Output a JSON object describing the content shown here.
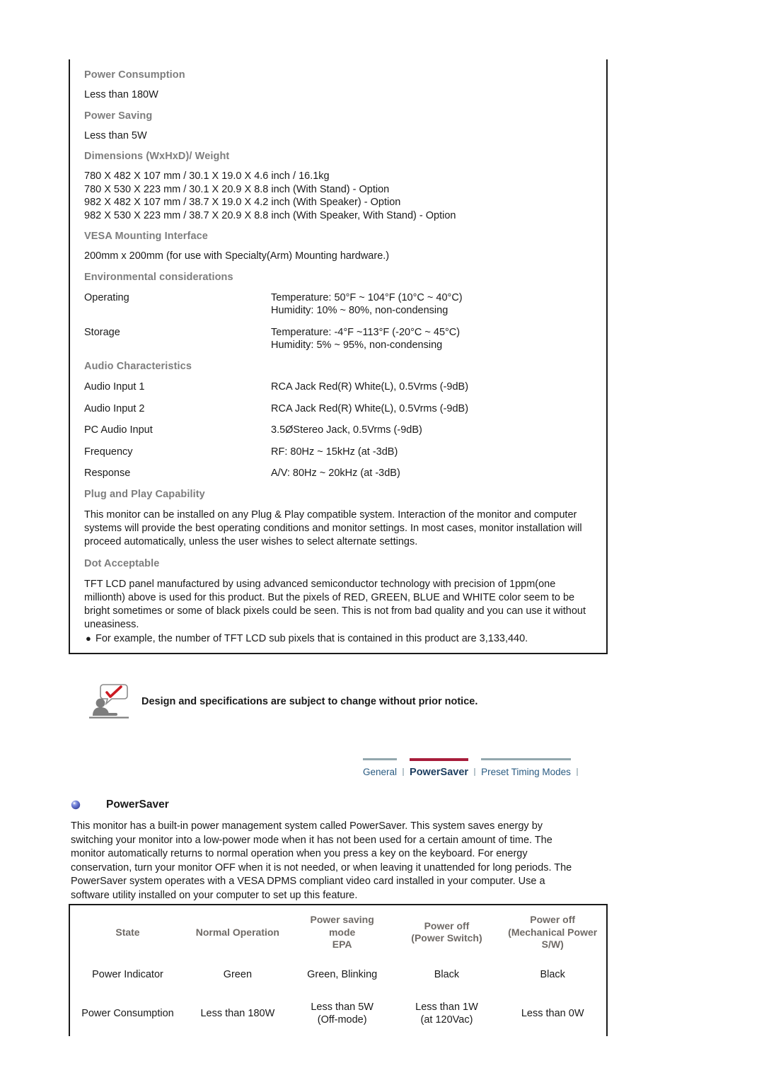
{
  "spec_box": {
    "sections": [
      {
        "kind": "heading",
        "text": "Power Consumption"
      },
      {
        "kind": "plain",
        "lines": [
          "Less than 180W"
        ]
      },
      {
        "kind": "heading",
        "text": "Power Saving"
      },
      {
        "kind": "plain",
        "lines": [
          "Less than 5W"
        ]
      },
      {
        "kind": "heading",
        "text": "Dimensions (WxHxD)/ Weight"
      },
      {
        "kind": "plain",
        "lines": [
          "780 X 482 X 107 mm / 30.1 X 19.0 X 4.6 inch / 16.1kg",
          "780 X 530 X 223 mm / 30.1 X 20.9 X 8.8 inch (With Stand) - Option",
          "982 X 482 X 107 mm / 38.7 X 19.0 X 4.2 inch (With Speaker) - Option",
          "982 X 530 X 223 mm / 38.7 X 20.9 X 8.8 inch (With Speaker, With Stand) - Option"
        ]
      },
      {
        "kind": "heading",
        "text": "VESA Mounting Interface"
      },
      {
        "kind": "plain",
        "lines": [
          "200mm x 200mm (for use with Specialty(Arm) Mounting hardware.)"
        ]
      },
      {
        "kind": "heading",
        "text": "Environmental considerations"
      },
      {
        "kind": "kv",
        "key": "Operating",
        "values": [
          "Temperature: 50°F ~ 104°F (10°C ~ 40°C)",
          "Humidity: 10% ~ 80%, non-condensing"
        ]
      },
      {
        "kind": "kv",
        "key": "Storage",
        "values": [
          "Temperature: -4°F ~113°F (-20°C ~ 45°C)",
          "Humidity: 5% ~ 95%, non-condensing"
        ]
      },
      {
        "kind": "heading",
        "text": "Audio Characteristics"
      },
      {
        "kind": "kv",
        "key": "Audio Input 1",
        "values": [
          "RCA Jack Red(R) White(L), 0.5Vrms (-9dB)"
        ]
      },
      {
        "kind": "kv",
        "key": "Audio Input 2",
        "values": [
          "RCA Jack Red(R) White(L), 0.5Vrms (-9dB)"
        ]
      },
      {
        "kind": "kv",
        "key": "PC Audio Input",
        "values": [
          "3.5ØStereo Jack, 0.5Vrms (-9dB)"
        ]
      },
      {
        "kind": "kv",
        "key": "Frequency",
        "values": [
          "RF: 80Hz ~ 15kHz (at -3dB)"
        ]
      },
      {
        "kind": "kv",
        "key": "Response",
        "values": [
          "A/V: 80Hz ~ 20kHz (at -3dB)"
        ]
      },
      {
        "kind": "heading",
        "text": "Plug and Play Capability"
      },
      {
        "kind": "para",
        "text": "This monitor can be installed on any Plug & Play compatible system. Interaction of the monitor and computer systems will provide the best operating conditions and monitor settings. In most cases, monitor installation will proceed automatically, unless the user wishes to select alternate settings."
      },
      {
        "kind": "heading",
        "text": "Dot Acceptable"
      },
      {
        "kind": "para",
        "text": "TFT LCD panel manufactured by using advanced semiconductor technology with precision of 1ppm(one millionth) above is used for this product. But the pixels of RED, GREEN, BLUE and WHITE color seem to be bright sometimes or some of black pixels could be seen. This is not from bad quality and you can use it without uneasiness."
      },
      {
        "kind": "bullet",
        "text": "For example, the number of TFT LCD sub pixels that is contained in this product are 3,133,440."
      }
    ]
  },
  "note": {
    "icon": "note-person-checkmark-icon",
    "text": "Design and specifications are subject to change without prior notice."
  },
  "tabs": {
    "items": [
      {
        "label": "General",
        "active": false
      },
      {
        "label": "PowerSaver",
        "active": true
      },
      {
        "label": "Preset Timing Modes",
        "active": false
      }
    ],
    "active_color": "#a81c3a",
    "inactive_line_color": "#93a7ae",
    "link_color": "#2a5b82"
  },
  "powersaver": {
    "bullet_icon": "blue-sphere-bullet-icon",
    "title": "PowerSaver",
    "paragraph": "This monitor has a built-in power management system called PowerSaver. This system saves energy by switching your monitor into a low-power mode when it has not been used for a certain amount of time. The monitor automatically returns to normal operation when you press a key on the keyboard. For energy conservation, turn your monitor OFF when it is not needed, or when leaving it unattended for long periods. The PowerSaver system operates with a VESA DPMS compliant video card installed in your computer. Use a software utility installed on your computer to set up this feature."
  },
  "power_table": {
    "headers": [
      "State",
      "Normal Operation",
      "Power saving mode\nEPA",
      "Power off\n(Power Switch)",
      "Power off\n(Mechanical Power S/W)"
    ],
    "header_lines": [
      [
        "State"
      ],
      [
        "Normal Operation"
      ],
      [
        "Power saving",
        "mode",
        "EPA"
      ],
      [
        "Power off",
        "(Power Switch)"
      ],
      [
        "Power off",
        "(Mechanical Power",
        "S/W)"
      ]
    ],
    "rows": [
      {
        "cells": [
          [
            "Power Indicator"
          ],
          [
            "Green"
          ],
          [
            "Green, Blinking"
          ],
          [
            "Black"
          ],
          [
            "Black"
          ]
        ]
      },
      {
        "cells": [
          [
            "Power Consumption"
          ],
          [
            "Less than 180W"
          ],
          [
            "Less than 5W",
            "(Off-mode)"
          ],
          [
            "Less than 1W",
            "(at 120Vac)"
          ],
          [
            "Less than 0W"
          ]
        ]
      }
    ]
  }
}
